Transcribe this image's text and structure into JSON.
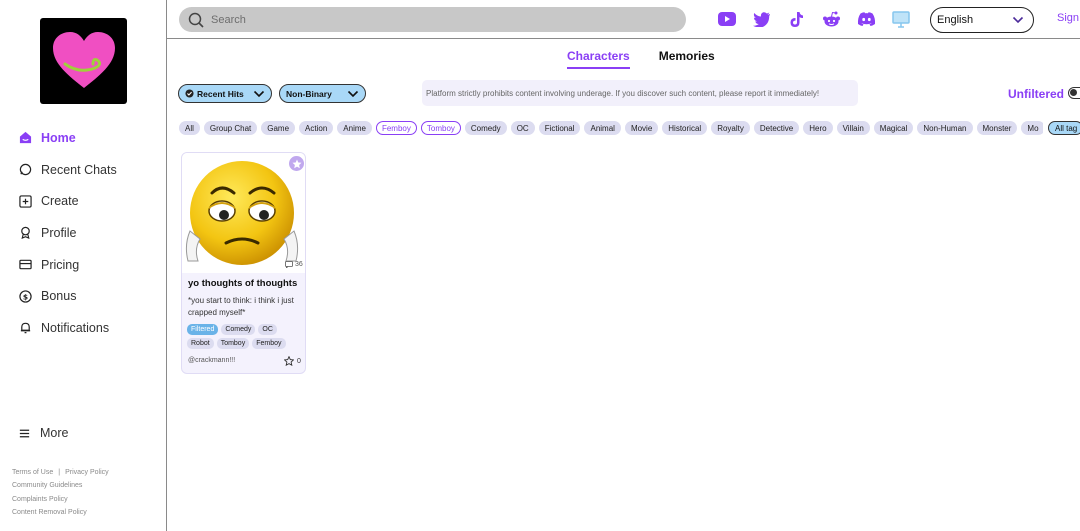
{
  "sidebar": {
    "nav": [
      {
        "label": "Home",
        "active": true,
        "icon": "home-icon"
      },
      {
        "label": "Recent Chats",
        "active": false,
        "icon": "chat-bubble-icon"
      },
      {
        "label": "Create",
        "active": false,
        "icon": "plus-square-icon"
      },
      {
        "label": "Profile",
        "active": false,
        "icon": "profile-icon"
      },
      {
        "label": "Pricing",
        "active": false,
        "icon": "card-icon"
      },
      {
        "label": "Bonus",
        "active": false,
        "icon": "dollar-icon"
      },
      {
        "label": "Notifications",
        "active": false,
        "icon": "bell-icon"
      }
    ],
    "more_label": "More",
    "footer": {
      "terms": "Terms of Use",
      "privacy": "Privacy Policy",
      "community": "Community Guidelines",
      "complaints": "Complaints Policy",
      "removal": "Content Removal Policy"
    }
  },
  "header": {
    "search_placeholder": "Search",
    "social_icons": [
      "youtube-icon",
      "twitter-icon",
      "tiktok-icon",
      "reddit-icon",
      "discord-icon",
      "monitor-icon"
    ],
    "language": "English",
    "signin_label": "Sign"
  },
  "tabs": [
    {
      "label": "Characters",
      "active": true
    },
    {
      "label": "Memories",
      "active": false
    }
  ],
  "filters": {
    "sort": "Recent Hits",
    "gender": "Non-Binary",
    "notice": "Platform strictly prohibits content involving underage. If you discover such content, please report it immediately!",
    "unfiltered_label": "Unfiltered"
  },
  "tags": [
    {
      "label": "All",
      "outline": false
    },
    {
      "label": "Group Chat",
      "outline": false
    },
    {
      "label": "Game",
      "outline": false
    },
    {
      "label": "Action",
      "outline": false
    },
    {
      "label": "Anime",
      "outline": false
    },
    {
      "label": "Femboy",
      "outline": true
    },
    {
      "label": "Tomboy",
      "outline": true
    },
    {
      "label": "Comedy",
      "outline": false
    },
    {
      "label": "OC",
      "outline": false
    },
    {
      "label": "Fictional",
      "outline": false
    },
    {
      "label": "Animal",
      "outline": false
    },
    {
      "label": "Movie",
      "outline": false
    },
    {
      "label": "Historical",
      "outline": false
    },
    {
      "label": "Royalty",
      "outline": false
    },
    {
      "label": "Detective",
      "outline": false
    },
    {
      "label": "Hero",
      "outline": false
    },
    {
      "label": "Villain",
      "outline": false
    },
    {
      "label": "Magical",
      "outline": false
    },
    {
      "label": "Non-Human",
      "outline": false
    },
    {
      "label": "Monster",
      "outline": false
    },
    {
      "label": "Mo",
      "outline": false
    }
  ],
  "all_tags_label": "All tag",
  "card": {
    "title": "yo thoughts of thoughts",
    "description": "*you start to think: i think i just crapped myself*",
    "chat_count": "36",
    "tags": [
      {
        "label": "Filtered",
        "filtered": true
      },
      {
        "label": "Comedy",
        "filtered": false
      },
      {
        "label": "OC",
        "filtered": false
      },
      {
        "label": "Robot",
        "filtered": false
      },
      {
        "label": "Tomboy",
        "filtered": false
      },
      {
        "label": "Femboy",
        "filtered": false
      }
    ],
    "author": "@crackmann!!!",
    "likes": "0"
  },
  "colors": {
    "accent": "#8a3ff5",
    "dropdown_bg": "#a9d8f7",
    "tag_bg": "#dcdcf0",
    "logo_heart": "#f04fc2"
  }
}
